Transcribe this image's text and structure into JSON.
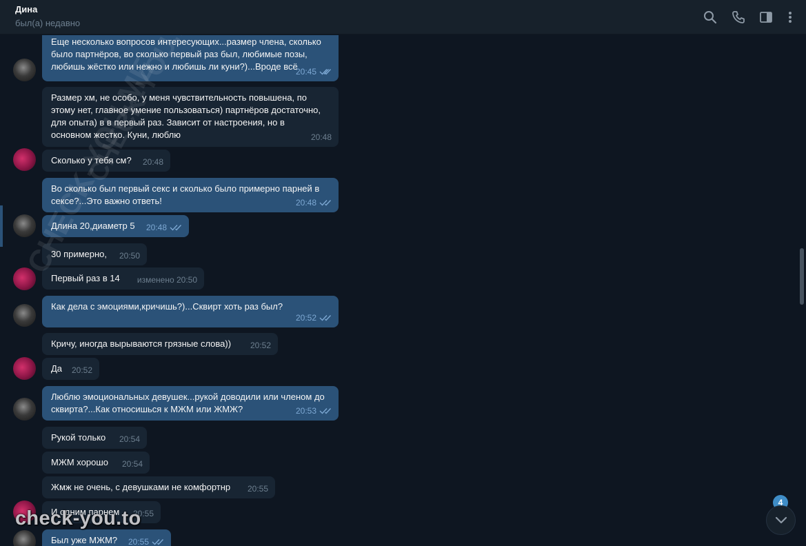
{
  "header": {
    "title": "Дина",
    "status": "был(а) недавно",
    "icons": [
      "search-icon",
      "phone-icon",
      "sidebar-toggle-icon",
      "more-icon"
    ]
  },
  "messages": [
    {
      "dir": "out",
      "text": "Еще несколько вопросов интересующих...размер члена, сколько было партнёров, во сколько первый раз был, любимые позы, любишь жёстко или нежно и любишь ли куни?)...Вроде всё",
      "time": "20:45",
      "read": true
    },
    {
      "dir": "in",
      "text": "Размер хм,  не особо, у меня чувствительность повышена, по этому нет, главное умение пользоваться) партнёров достаточно, для опыта) в в первый раз. Зависит от настроения, но в основном жестко. Куни, люблю",
      "time": "20:48"
    },
    {
      "dir": "in",
      "text": "Сколько у тебя см?",
      "time": "20:48"
    },
    {
      "dir": "out",
      "text": "Во сколько был первый секс и сколько было примерно парней в сексе?...Это важно ответь!",
      "time": "20:48",
      "read": true
    },
    {
      "dir": "out",
      "text": "Длина 20,диаметр 5",
      "time": "20:48",
      "read": true
    },
    {
      "dir": "in",
      "text": "30 примерно,",
      "time": "20:50"
    },
    {
      "dir": "in",
      "text": "Первый раз  в 14",
      "time": "изменено 20:50"
    },
    {
      "dir": "out",
      "text": "Как дела с эмоциями,кричишь?)...Сквирт хоть раз был?",
      "time": "20:52",
      "read": true
    },
    {
      "dir": "in",
      "text": "Кричу, иногда  вырываются грязные слова))",
      "time": "20:52"
    },
    {
      "dir": "in",
      "text": "Да",
      "time": "20:52"
    },
    {
      "dir": "out",
      "text": "Люблю эмоциональных девушек...рукой доводили или членом до сквирта?...Как относишься к МЖМ или ЖМЖ?",
      "time": "20:53",
      "read": true
    },
    {
      "dir": "in",
      "text": "Рукой только",
      "time": "20:54"
    },
    {
      "dir": "in",
      "text": "МЖМ хорошо",
      "time": "20:54"
    },
    {
      "dir": "in",
      "text": "Жмж не очень, с девушками не комфортнр",
      "time": "20:55"
    },
    {
      "dir": "in",
      "text": "И одним парнем",
      "time": "20:55"
    },
    {
      "dir": "out",
      "text": "Был уже МЖМ?",
      "time": "20:55",
      "read": true
    }
  ],
  "scroll_down": {
    "unread_count": "4",
    "icon": "chevron-down-icon"
  },
  "watermark": {
    "text": "check-you.to",
    "diagonal": "CHECK-YOU.ME"
  },
  "colors": {
    "background": "#0e1621",
    "header": "#17212b",
    "outgoing_bubble": "#2b5278",
    "incoming_bubble": "#182533",
    "accent": "#3f8dc7"
  }
}
